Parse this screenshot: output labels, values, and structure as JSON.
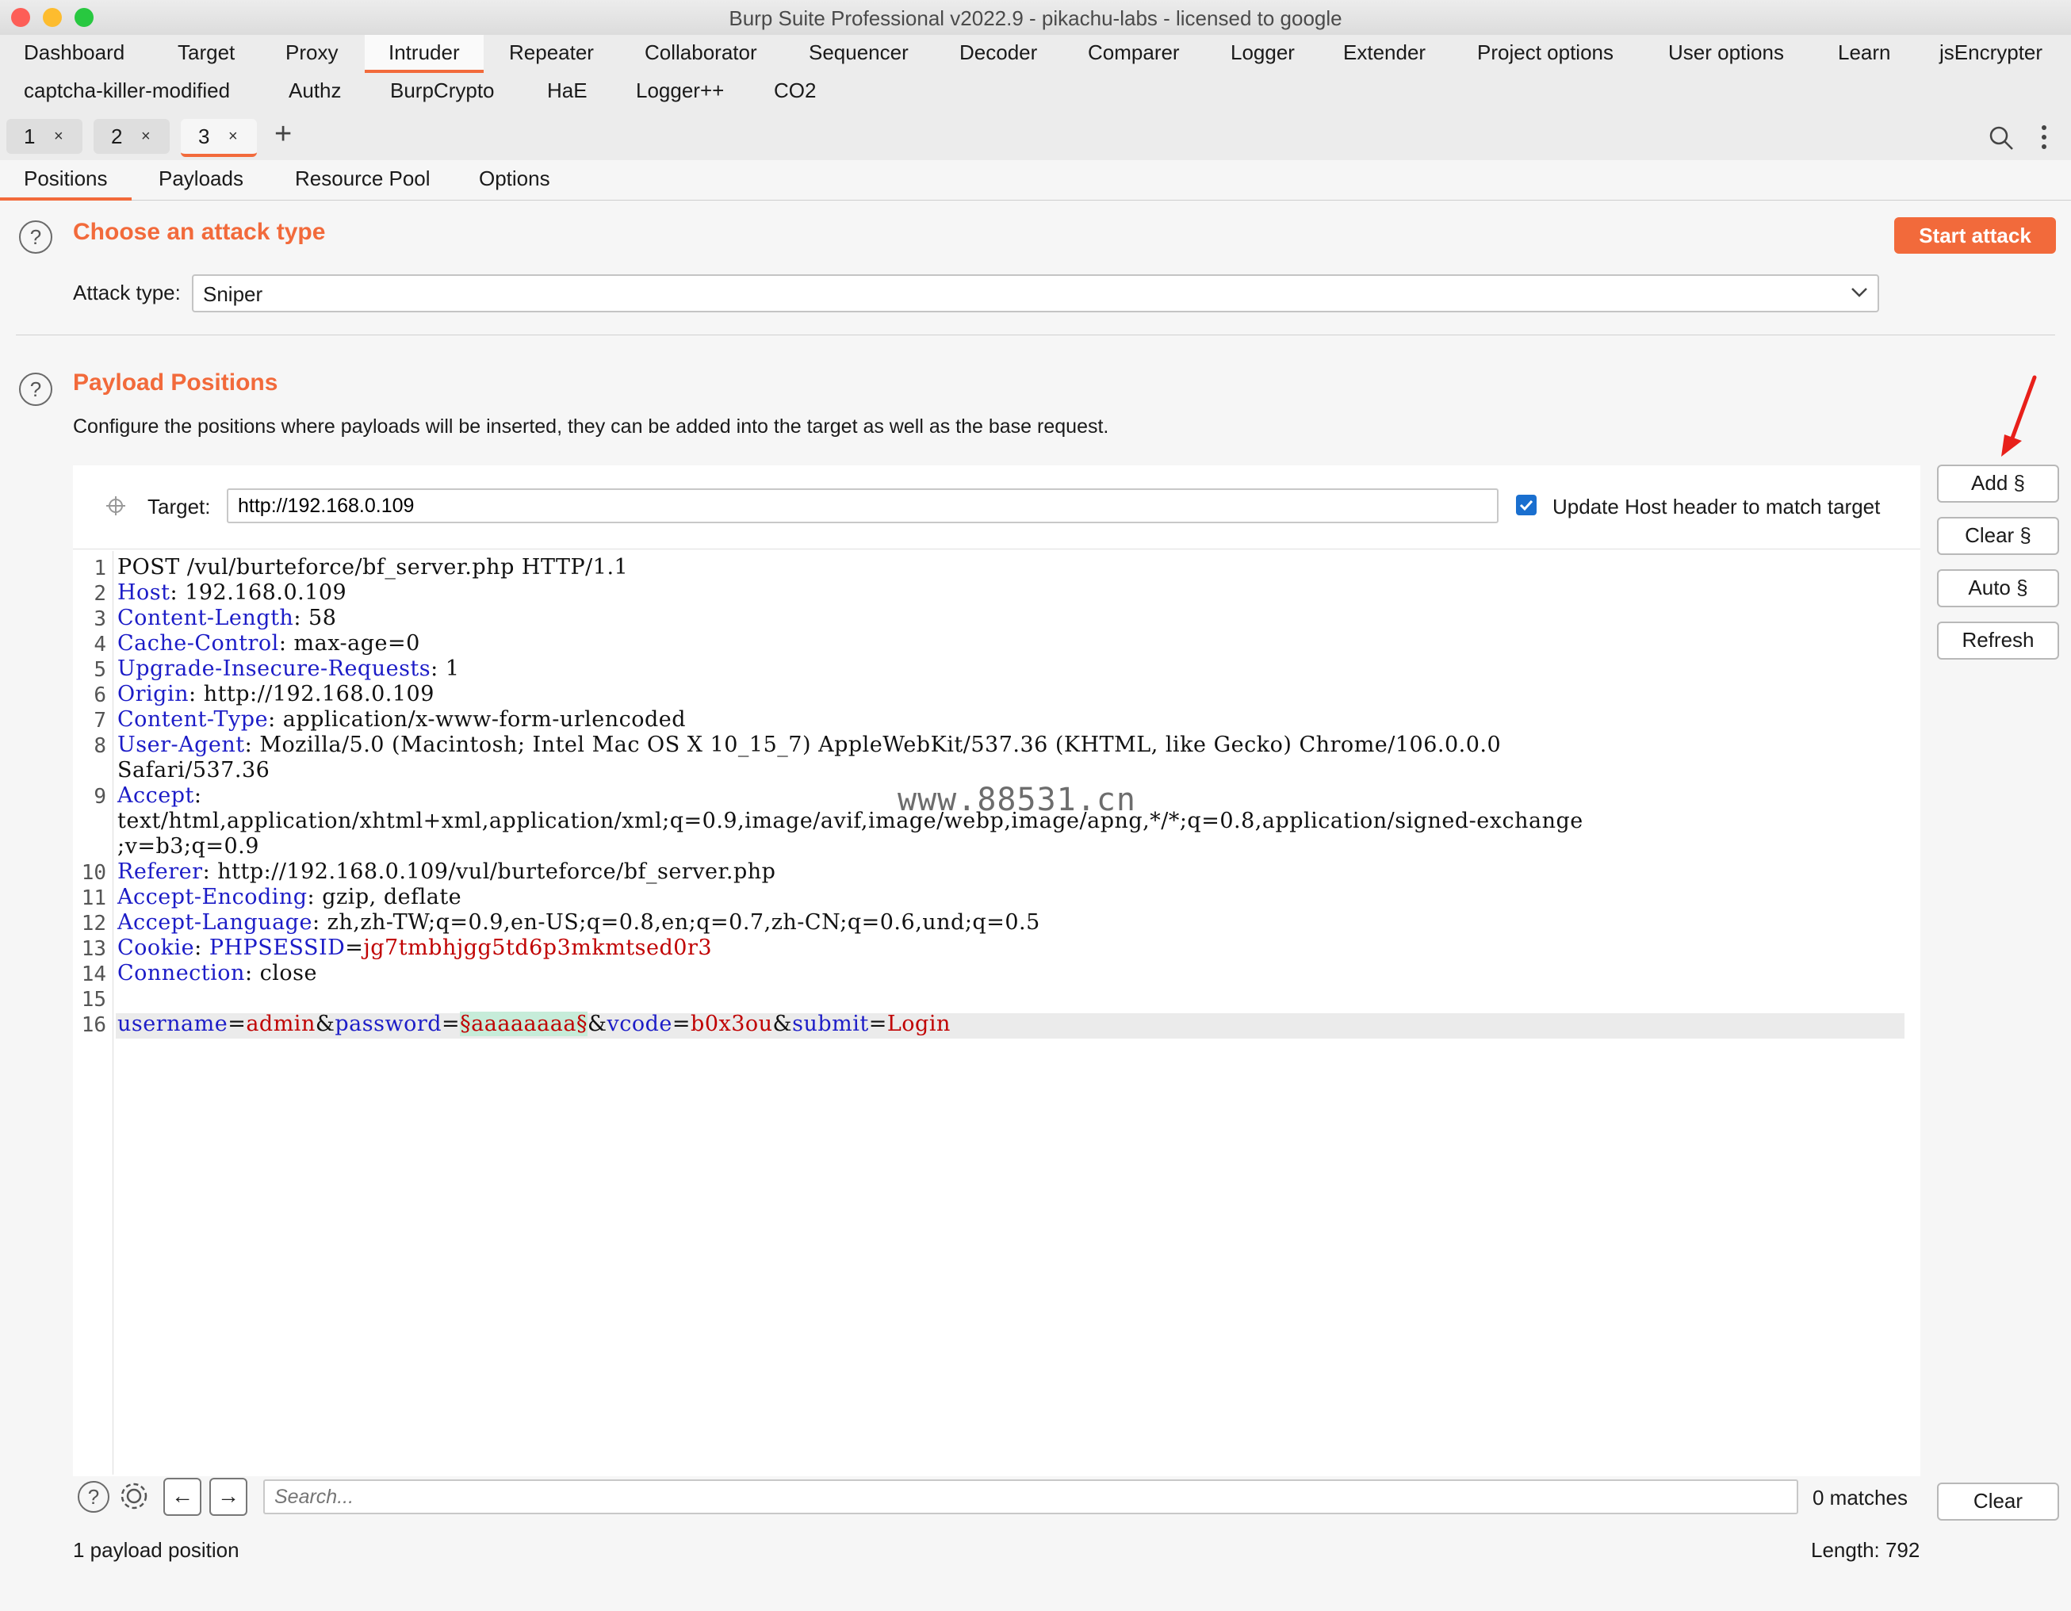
{
  "window": {
    "title": "Burp Suite Professional v2022.9 - pikachu-labs - licensed to google"
  },
  "nav": {
    "row1": [
      "Dashboard",
      "Target",
      "Proxy",
      "Intruder",
      "Repeater",
      "Collaborator",
      "Sequencer",
      "Decoder",
      "Comparer",
      "Logger",
      "Extender",
      "Project options",
      "User options",
      "Learn",
      "jsEncrypter"
    ],
    "row2": [
      "captcha-killer-modified",
      "Authz",
      "BurpCrypto",
      "HaE",
      "Logger++",
      "CO2"
    ]
  },
  "tabs": [
    {
      "num": "1",
      "close": "×"
    },
    {
      "num": "2",
      "close": "×"
    },
    {
      "num": "3",
      "close": "×"
    }
  ],
  "tab_add": "+",
  "subtabs": [
    "Positions",
    "Payloads",
    "Resource Pool",
    "Options"
  ],
  "attack": {
    "section_title": "Choose an attack type",
    "start_button": "Start attack",
    "type_label": "Attack type:",
    "type_value": "Sniper"
  },
  "positions": {
    "section_title": "Payload Positions",
    "description": "Configure the positions where payloads will be inserted, they can be added into the target as well as the base request.",
    "target_label": "Target:",
    "target_value": "http://192.168.0.109",
    "update_host_label": "Update Host header to match target",
    "update_host_checked": true,
    "buttons": {
      "add": "Add §",
      "clear": "Clear §",
      "auto": "Auto §",
      "refresh": "Refresh"
    }
  },
  "request": {
    "line_numbers": [
      "1",
      "2",
      "3",
      "4",
      "5",
      "6",
      "7",
      "8",
      "",
      "9",
      "",
      "",
      "10",
      "11",
      "12",
      "13",
      "14",
      "15",
      "16"
    ],
    "request_line": "POST /vul/burteforce/bf_server.php HTTP/1.1",
    "headers": [
      {
        "name": "Host",
        "value": "192.168.0.109"
      },
      {
        "name": "Content-Length",
        "value": "58"
      },
      {
        "name": "Cache-Control",
        "value": "max-age=0"
      },
      {
        "name": "Upgrade-Insecure-Requests",
        "value": "1"
      },
      {
        "name": "Origin",
        "value": "http://192.168.0.109"
      },
      {
        "name": "Content-Type",
        "value": "application/x-www-form-urlencoded"
      },
      {
        "name": "User-Agent",
        "value": "Mozilla/5.0 (Macintosh; Intel Mac OS X 10_15_7) AppleWebKit/537.36 (KHTML, like Gecko) Chrome/106.0.0.0"
      },
      {
        "name": "",
        "value": "Safari/537.36"
      },
      {
        "name": "Accept",
        "value": ""
      },
      {
        "name": "",
        "value": "text/html,application/xhtml+xml,application/xml;q=0.9,image/avif,image/webp,image/apng,*/*;q=0.8,application/signed-exchange"
      },
      {
        "name": "",
        "value": ";v=b3;q=0.9"
      },
      {
        "name": "Referer",
        "value": "http://192.168.0.109/vul/burteforce/bf_server.php"
      },
      {
        "name": "Accept-Encoding",
        "value": "gzip, deflate"
      },
      {
        "name": "Accept-Language",
        "value": "zh,zh-TW;q=0.9,en-US;q=0.8,en;q=0.7,zh-CN;q=0.6,und;q=0.5"
      },
      {
        "name": "Connection",
        "value": "close"
      }
    ],
    "cookie": {
      "name": "Cookie",
      "param": "PHPSESSID",
      "value": "jg7tmbhjgg5td6p3mkmtsed0r3"
    },
    "body": [
      {
        "key": "username",
        "value": "admin"
      },
      {
        "key": "password",
        "value": "§aaaaaaaa§",
        "marked": true
      },
      {
        "key": "vcode",
        "value": "b0x3ou"
      },
      {
        "key": "submit",
        "value": "Login"
      }
    ]
  },
  "watermark": "www.88531.cn",
  "search": {
    "placeholder": "Search...",
    "matches": "0 matches",
    "clear": "Clear"
  },
  "status": {
    "positions": "1 payload position",
    "length": "Length: 792"
  },
  "colors": {
    "accent": "#f26a3b",
    "header_name": "#1c1cc7",
    "param_value": "#c00000",
    "marker_bg": "#c6ecd9"
  }
}
